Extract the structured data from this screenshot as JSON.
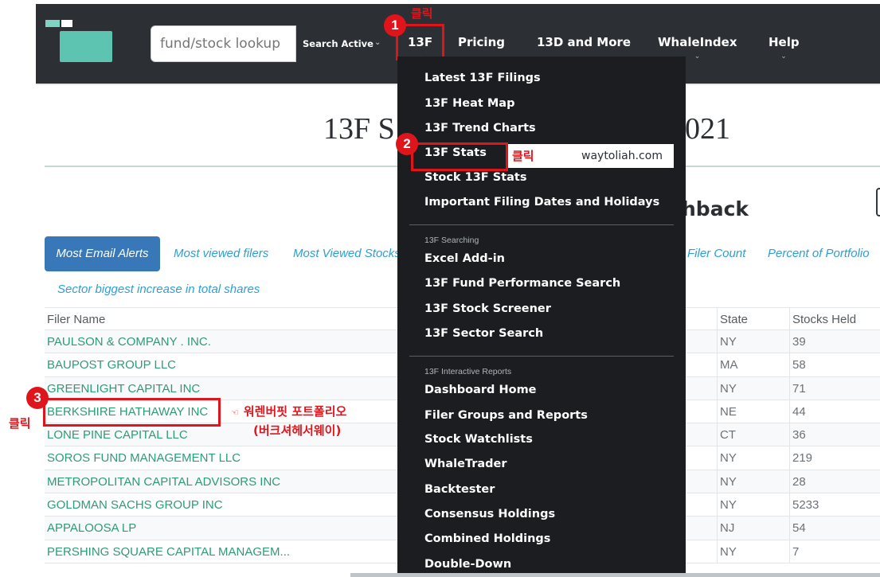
{
  "header": {
    "search": {
      "placeholder": "fund/stock lookup",
      "select_label": "Search Active"
    },
    "nav": [
      {
        "label": "13F"
      },
      {
        "label": "Pricing"
      },
      {
        "label": "13D and More"
      },
      {
        "label": "WhaleIndex"
      },
      {
        "label": "Help"
      }
    ]
  },
  "page": {
    "title_left": "13F S",
    "title_right": "021",
    "subhead": "hback"
  },
  "tabs": [
    {
      "label": "Most Email Alerts",
      "active": true
    },
    {
      "label": "Most viewed filers"
    },
    {
      "label": "Most Viewed Stocks"
    },
    {
      "label": "Filer Count"
    },
    {
      "label": "Percent of Portfolio"
    },
    {
      "label": "Sector biggest increase in total shares"
    }
  ],
  "table": {
    "columns": [
      "Filer Name",
      "State",
      "Stocks Held"
    ],
    "rows": [
      {
        "name": "PAULSON & COMPANY . INC.",
        "state": "NY",
        "stocks": "39"
      },
      {
        "name": "BAUPOST GROUP LLC",
        "state": "MA",
        "stocks": "58"
      },
      {
        "name": "GREENLIGHT CAPITAL INC",
        "state": "NY",
        "stocks": "71"
      },
      {
        "name": "BERKSHIRE HATHAWAY INC",
        "state": "NE",
        "stocks": "44"
      },
      {
        "name": "LONE PINE CAPITAL LLC",
        "state": "CT",
        "stocks": "36"
      },
      {
        "name": "SOROS FUND MANAGEMENT LLC",
        "state": "NY",
        "stocks": "219"
      },
      {
        "name": "METROPOLITAN CAPITAL ADVISORS INC",
        "state": "NY",
        "stocks": "28"
      },
      {
        "name": "GOLDMAN SACHS GROUP INC",
        "state": "NY",
        "stocks": "5233"
      },
      {
        "name": "APPALOOSA LP",
        "state": "NJ",
        "stocks": "54"
      },
      {
        "name": "PERSHING SQUARE CAPITAL MANAGEM...",
        "state": "NY",
        "stocks": "7"
      }
    ]
  },
  "dropdown": {
    "items_top": [
      "Latest 13F Filings",
      "13F Heat Map",
      "13F Trend Charts",
      "13F Stats",
      "Stock 13F Stats",
      "Important Filing Dates and Holidays"
    ],
    "section_searching": "13F Searching",
    "items_searching": [
      "Excel Add-in",
      "13F Fund Performance Search",
      "13F Stock Screener",
      "13F Sector Search"
    ],
    "section_reports": "13F Interactive Reports",
    "items_reports": [
      "Dashboard Home",
      "Filer Groups and Reports",
      "Stock Watchlists",
      "WhaleTrader",
      "Backtester",
      "Consensus Holdings",
      "Combined Holdings",
      "Double-Down"
    ]
  },
  "annotations": {
    "click_label": "클릭",
    "step1": "1",
    "step2": "2",
    "step3": "3",
    "watermark": "waytoliah.com",
    "note_line1": "워렌버핏 포트폴리오",
    "note_line2": "(버크셔헤서웨이)",
    "hand_glyph": "☜"
  },
  "colors": {
    "header_bg": "#2c3035",
    "menu_bg": "#1b1d21",
    "accent_red": "#e0151b",
    "link_green": "#2f9a78",
    "tab_active": "#3978b8",
    "tab_link": "#2e9fd3",
    "logo_teal": "#5ec4b2"
  }
}
